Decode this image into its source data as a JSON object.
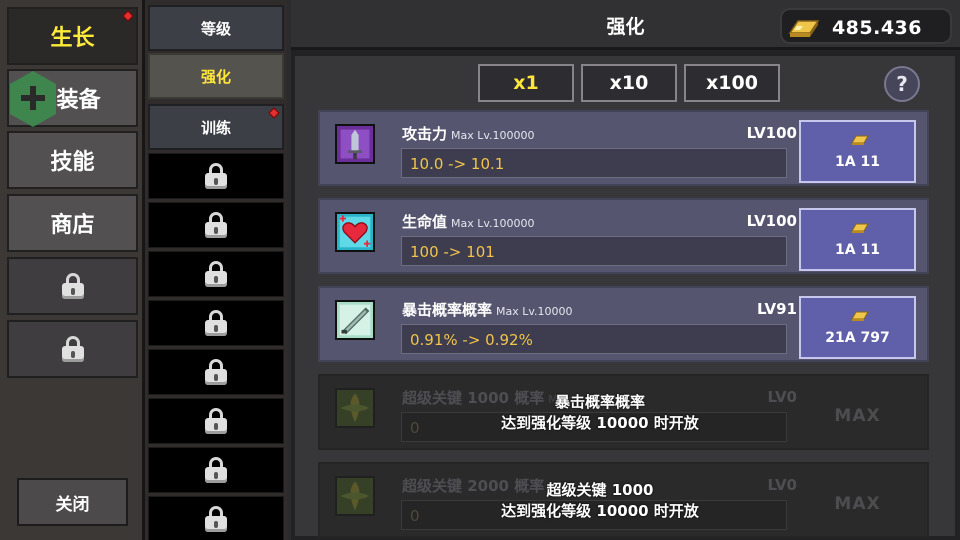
{
  "nav": {
    "main_tabs": [
      {
        "label": "生长",
        "active": true,
        "alert": true
      },
      {
        "label": "装备",
        "active": false,
        "alert": false
      },
      {
        "label": "技能",
        "active": false,
        "alert": false
      },
      {
        "label": "商店",
        "active": false,
        "alert": false
      }
    ],
    "locked_tab_count": 2,
    "close_label": "关闭"
  },
  "sub_nav": {
    "tabs": [
      {
        "label": "等级",
        "state": "open",
        "alert": false
      },
      {
        "label": "强化",
        "state": "active",
        "alert": false
      },
      {
        "label": "训练",
        "state": "open",
        "alert": true
      }
    ],
    "locked_count": 8
  },
  "header": {
    "title": "强化",
    "gold": "485.436"
  },
  "multipliers": [
    {
      "label": "x1",
      "active": true
    },
    {
      "label": "x10",
      "active": false
    },
    {
      "label": "x100",
      "active": false
    }
  ],
  "help_label": "?",
  "upgrades": [
    {
      "name": "攻击力",
      "max": "Max Lv.100000",
      "level": "LV100",
      "value": "10.0 -> 10.1",
      "cost": "1A 11",
      "icon": "sword-icon",
      "locked": false
    },
    {
      "name": "生命值",
      "max": "Max Lv.100000",
      "level": "LV100",
      "value": "100 -> 101",
      "cost": "1A 11",
      "icon": "heart-icon",
      "locked": false
    },
    {
      "name": "暴击概率概率",
      "max": "Max Lv.10000",
      "level": "LV91",
      "value": "0.91% -> 0.92%",
      "cost": "21A 797",
      "icon": "blade-icon",
      "locked": false
    },
    {
      "name": "超级关键 1000 概率",
      "max": "Max",
      "level": "LV0",
      "value": "0",
      "cost": "MAX",
      "icon": "leaf-icon",
      "locked": true,
      "lock_line1": "暴击概率概率",
      "lock_line2": "达到强化等级 10000 时开放"
    },
    {
      "name": "超级关键 2000 概率",
      "max": "",
      "level": "LV0",
      "value": "0",
      "cost": "MAX",
      "icon": "leaf-icon",
      "locked": true,
      "lock_line1": "超级关键 1000",
      "lock_line2": "达到强化等级 10000 时开放"
    }
  ],
  "colors": {
    "accent_yellow": "#ffe73a",
    "row_bg": "#55556f",
    "upgrade_btn": "#6060aa",
    "value_text": "#f3c34b",
    "alert_red": "#e23030"
  }
}
